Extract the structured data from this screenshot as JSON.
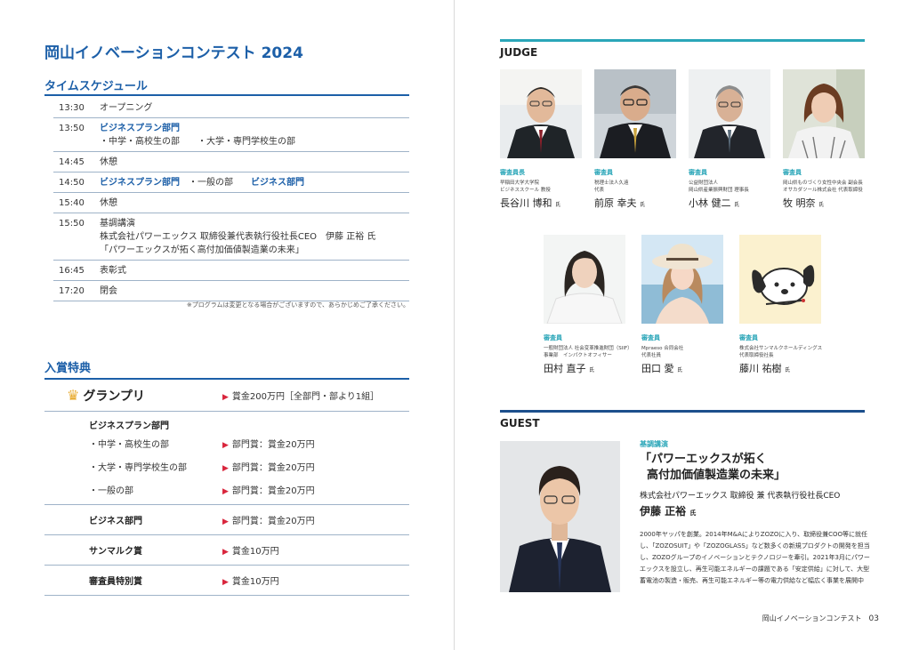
{
  "left": {
    "title": "岡山イノベーションコンテスト 2024",
    "schedule": {
      "heading": "タイムスケジュール",
      "rows": [
        {
          "time": "13:30",
          "text": "オープニング"
        },
        {
          "time": "13:50",
          "text": "ビジネスプラン部門",
          "sub": "・中学・高校生の部　　・大学・専門学校生の部"
        },
        {
          "time": "14:45",
          "text": "休憩"
        },
        {
          "time": "14:50",
          "text": "ビジネスプラン部門",
          "mid": "・一般の部",
          "tail": "ビジネス部門"
        },
        {
          "time": "15:40",
          "text": "休憩"
        },
        {
          "time": "15:50",
          "text": "基調講演",
          "sub": "株式会社パワーエックス 取締役兼代表執行役社長CEO　伊藤 正裕 氏",
          "sub2": "「パワーエックスが拓く高付加価値製造業の未来」"
        },
        {
          "time": "16:45",
          "text": "表彰式"
        },
        {
          "time": "17:20",
          "text": "閉会"
        }
      ],
      "note": "※プログラムは変更となる場合がございますので、あらかじめご了承ください。"
    },
    "prizes": {
      "heading": "入賞特典",
      "grand": {
        "name": "グランプリ",
        "value": "賞金200万円［全部門・部より1組］"
      },
      "bp_heading": "ビジネスプラン部門",
      "bp_rows": [
        {
          "name": "・中学・高校生の部",
          "value": "部門賞：賞金20万円"
        },
        {
          "name": "・大学・専門学校生の部",
          "value": "部門賞：賞金20万円"
        },
        {
          "name": "・一般の部",
          "value": "部門賞：賞金20万円"
        }
      ],
      "others": [
        {
          "name": "ビジネス部門",
          "value": "部門賞：賞金20万円"
        },
        {
          "name": "サンマルク賞",
          "value": "賞金10万円"
        },
        {
          "name": "審査員特別賞",
          "value": "賞金10万円"
        }
      ]
    }
  },
  "right": {
    "judge_heading": "JUDGE",
    "judges": [
      {
        "role": "審査員長",
        "org1": "早稲田大学大学院",
        "org2": "ビジネススクール 教授",
        "name": "長谷川 博和",
        "suffix": "氏"
      },
      {
        "role": "審査員",
        "org1": "税理士法人久遠",
        "org2": "代表",
        "name": "前原 幸夫",
        "suffix": "氏"
      },
      {
        "role": "審査員",
        "org1": "公益財団法人",
        "org2": "岡山県産業振興財団 理事長",
        "name": "小林 健二",
        "suffix": "氏"
      },
      {
        "role": "審査員",
        "org1": "岡山県ものづくり女性中央会 副会長",
        "org2": "オサカダツール株式会社 代表取締役",
        "name": "牧 明奈",
        "suffix": "氏"
      },
      {
        "role": "審査員",
        "org1": "一般財団法人 社会変革推進財団（SIIF）",
        "org2": "事業部　インパクトオフィサー",
        "name": "田村 直子",
        "suffix": "氏"
      },
      {
        "role": "審査員",
        "org1": "Mpraeso 合同会社",
        "org2": "代表社員",
        "name": "田口 愛",
        "suffix": "氏"
      },
      {
        "role": "審査員",
        "org1": "株式会社サンマルクホールディングス",
        "org2": "代表取締役社長",
        "name": "藤川 祐樹",
        "suffix": "氏"
      }
    ],
    "guest_heading": "GUEST",
    "guest": {
      "label": "基調講演",
      "title1": "「パワーエックスが拓く",
      "title2": "高付加価値製造業の未来」",
      "company": "株式会社パワーエックス 取締役 兼 代表執行役社長CEO",
      "name": "伊藤 正裕",
      "suffix": "氏",
      "bio": "2000年ヤッパを創業。2014年M&AによりZOZOに入り、取締役兼COO等に就任し、「ZOZOSUIT」や「ZOZOGLASS」など数多くの新規プロダクトの開発を担当し、ZOZOグループのイノベーションとテクノロジーを牽引。2021年3月にパワーエックスを設立し、再生可能エネルギーの課題である「安定供給」に対して、大型蓄電池の製造・販売、再生可能エネルギー等の電力供給など幅広く事業を展開中"
    },
    "footer": {
      "title": "岡山イノベーションコンテスト",
      "page": "03"
    }
  }
}
